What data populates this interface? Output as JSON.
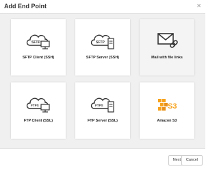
{
  "dialog": {
    "title": "Add End Point",
    "close_glyph": "✕"
  },
  "cards": [
    {
      "label": "SFTP Client (SSH)",
      "icon": "sftp-client-icon",
      "badge": "SFTP"
    },
    {
      "label": "SFTP Server (SSH)",
      "icon": "sftp-server-icon",
      "badge": "SFTP"
    },
    {
      "label": "Mail with file links",
      "icon": "mail-link-icon"
    },
    {
      "label": "FTP Client (SSL)",
      "icon": "ftps-client-icon",
      "badge": "FTPS"
    },
    {
      "label": "FTP Server (SSL)",
      "icon": "ftps-server-icon",
      "badge": "FTPS"
    },
    {
      "label": "Amazon S3",
      "icon": "amazon-s3-icon",
      "badge": "S3"
    }
  ],
  "footer": {
    "next_label": "Next",
    "cancel_label": "Cancel"
  },
  "colors": {
    "s3_orange": "#f7a21b",
    "icon_dark": "#333333"
  }
}
